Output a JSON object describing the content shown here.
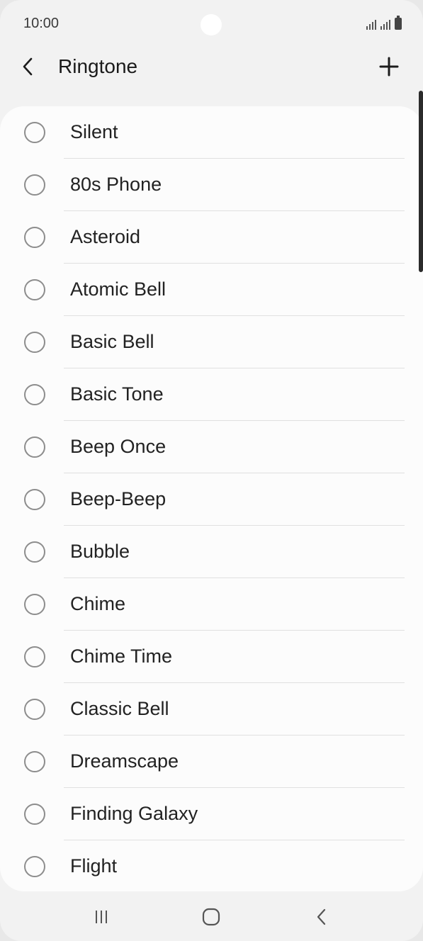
{
  "status_bar": {
    "time": "10:00"
  },
  "header": {
    "title": "Ringtone",
    "back_icon": "chevron-left-icon",
    "add_icon": "plus-icon"
  },
  "ringtones": [
    {
      "label": "Silent",
      "selected": false
    },
    {
      "label": "80s Phone",
      "selected": false
    },
    {
      "label": "Asteroid",
      "selected": false
    },
    {
      "label": "Atomic Bell",
      "selected": false
    },
    {
      "label": "Basic Bell",
      "selected": false
    },
    {
      "label": "Basic Tone",
      "selected": false
    },
    {
      "label": "Beep Once",
      "selected": false
    },
    {
      "label": "Beep-Beep",
      "selected": false
    },
    {
      "label": "Bubble",
      "selected": false
    },
    {
      "label": "Chime",
      "selected": false
    },
    {
      "label": "Chime Time",
      "selected": false
    },
    {
      "label": "Classic Bell",
      "selected": false
    },
    {
      "label": "Dreamscape",
      "selected": false
    },
    {
      "label": "Finding Galaxy",
      "selected": false
    },
    {
      "label": "Flight",
      "selected": false
    }
  ],
  "nav_bar": {
    "recents_icon": "recents-icon",
    "home_icon": "home-icon",
    "back_icon": "back-icon"
  },
  "colors": {
    "background": "#f2f2f2",
    "card": "#fcfcfc",
    "radio_border": "#8d8d8d",
    "divider": "#e0e0e0"
  }
}
